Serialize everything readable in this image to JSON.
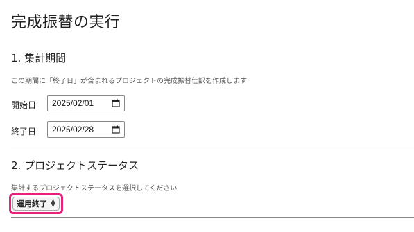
{
  "page": {
    "title": "完成振替の実行"
  },
  "period": {
    "heading": "1. 集計期間",
    "description": "この期間に「終了日」が含まれるプロジェクトの完成振替仕訳を作成します",
    "start_label": "開始日",
    "start_value": "2025/02/01",
    "end_label": "終了日",
    "end_value": "2025/02/28"
  },
  "status": {
    "heading": "2. プロジェクトステータス",
    "description": "集計するプロジェクトステータスを選択してください",
    "selected": "運用終了"
  },
  "colors": {
    "highlight": "#e8207a"
  }
}
